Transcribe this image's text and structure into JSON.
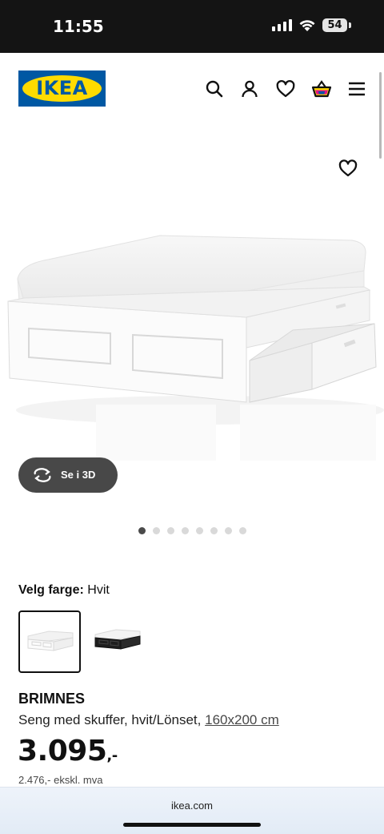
{
  "status_bar": {
    "time": "11:55",
    "battery": "54"
  },
  "header": {
    "logo_text": "IKEA",
    "icons": [
      "search-icon",
      "user-icon",
      "heart-icon",
      "basket-icon",
      "menu-icon"
    ]
  },
  "gallery": {
    "view_3d_label": "Se i 3D",
    "image_count": 8,
    "active_index": 0
  },
  "color_picker": {
    "label": "Velg farge:",
    "value": "Hvit",
    "options": [
      "white",
      "black"
    ],
    "selected": 0
  },
  "product": {
    "name": "BRIMNES",
    "description": "Seng med skuffer, hvit/Lönset,",
    "size": "160x200 cm",
    "price": "3.095",
    "price_suffix": ",-",
    "price_ex_vat": "2.476,- ekskl. mva"
  },
  "browser": {
    "url": "ikea.com"
  },
  "colors": {
    "brand_blue": "#0058a3",
    "brand_yellow": "#ffdb00",
    "button_dark": "#484848"
  }
}
